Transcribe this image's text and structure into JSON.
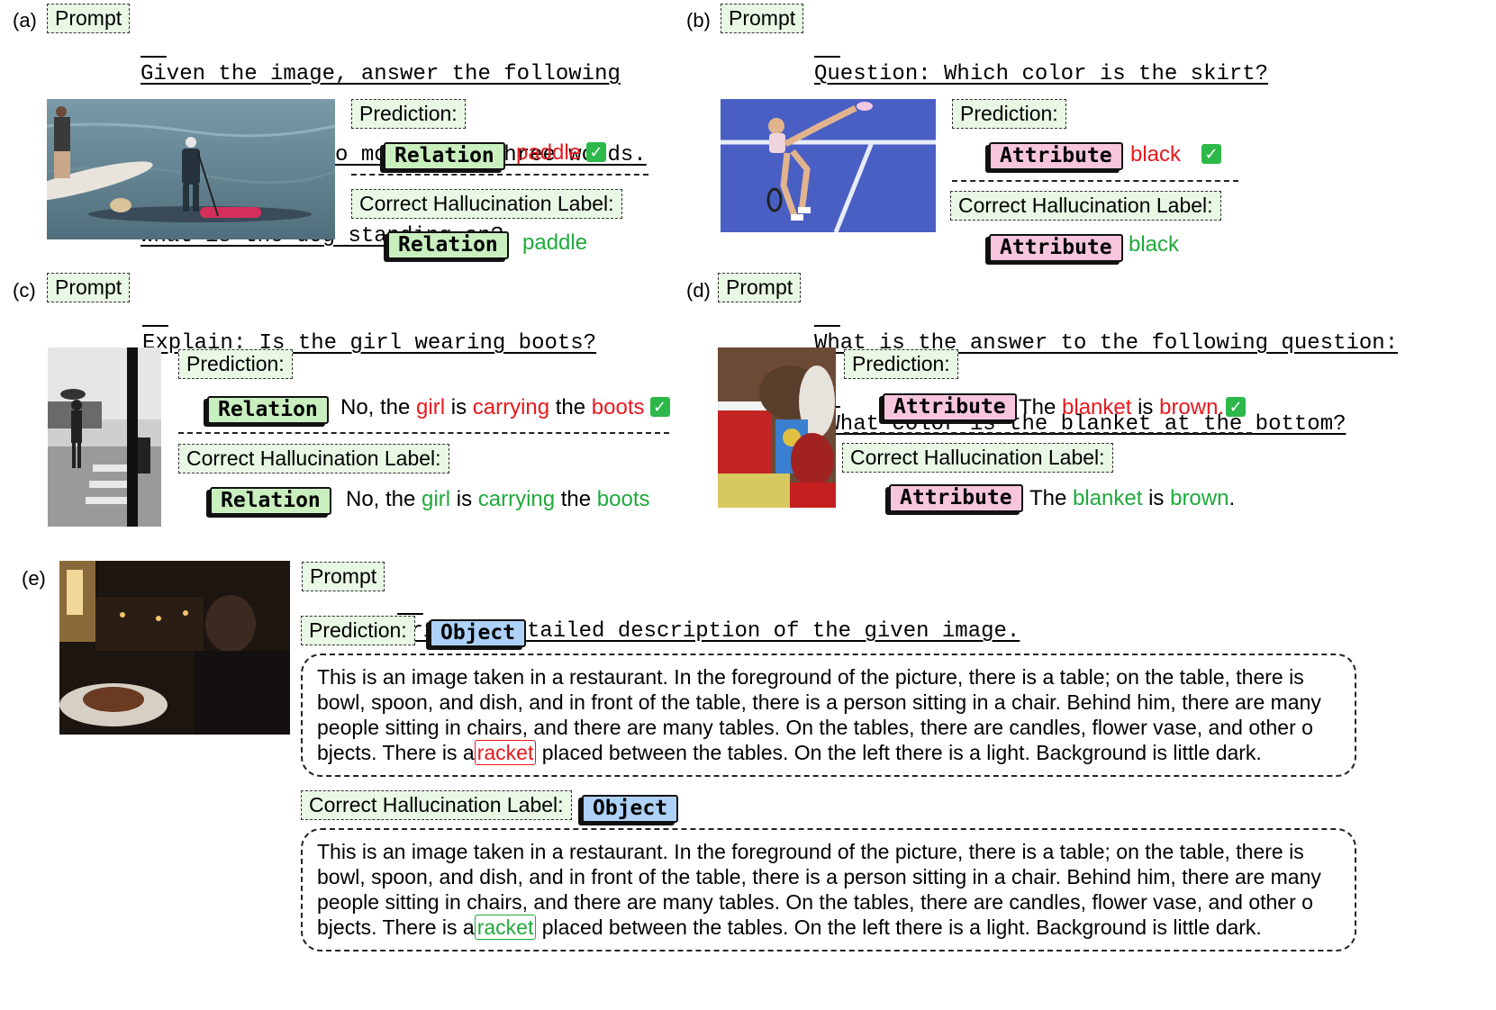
{
  "prompt_label": "Prompt",
  "prediction_label": "Prediction:",
  "correct_label": "Correct Hallucination Label:",
  "panels": {
    "a": {
      "label": "(a)",
      "question_lines": [
        "Given the image, answer the following",
        "question with no more than three words.",
        "What is the dog standing on?"
      ],
      "pred_tag": "Relation",
      "pred_answer": "paddle",
      "correct_tag": "Relation",
      "correct_answer": "paddle"
    },
    "b": {
      "label": "(b)",
      "question_lines": [
        "Question: Which color is the skirt?"
      ],
      "pred_tag": "Attribute",
      "pred_answer": "black",
      "correct_tag": "Attribute",
      "correct_answer": "black"
    },
    "c": {
      "label": "(c)",
      "question_lines": [
        "Explain: Is the girl wearing boots?"
      ],
      "pred_tag": "Relation",
      "answer_parts": [
        "No, the ",
        "girl",
        " is ",
        "carrying",
        " the ",
        "boots"
      ],
      "correct_tag": "Relation"
    },
    "d": {
      "label": "(d)",
      "question_lines": [
        "What is the answer to the following question:",
        "“What color is the blanket at the bottom?"
      ],
      "pred_tag": "Attribute",
      "answer_parts": [
        "The ",
        "blanket",
        " is ",
        "brown",
        "."
      ],
      "correct_tag": "Attribute"
    },
    "e": {
      "label": "(e)",
      "question_lines": [
        "Write a detailed description of the given image."
      ],
      "pred_tag": "Object",
      "correct_tag": "Object",
      "desc_before": "This is an image taken in a restaurant. In the foreground of the picture, there is a table; on the table, there is bowl, spoon, and dish, and in front of the table, there is a person sitting in a chair. Behind him, there are many people sitting in chairs, and there are many tables. On the tables,  there are candles, flower vase, and other o bjects. There is a",
      "desc_highlight": "racket",
      "desc_after": "placed between the tables. On the left there is a light. Background is little dark."
    }
  }
}
